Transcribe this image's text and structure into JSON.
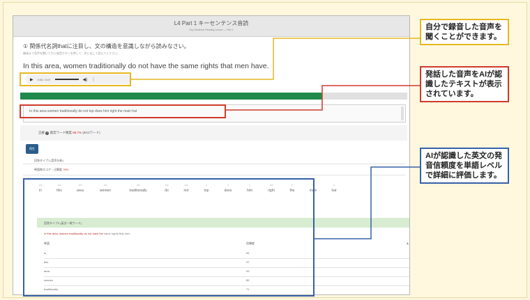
{
  "header": {
    "title": "L4 Part 1 キーセンテンス音読",
    "subtitle": "Key Sentence Reading Lesson — Part 1"
  },
  "question": {
    "text": "① 関係代名詞thatに注目し、文の構造を意識しながら読みなさい。",
    "note": "最後まで音声を聞いてから録音ボタンを押して、声に出して読んでください。",
    "sentence": "In this area, women traditionally do not have the same rights that men have."
  },
  "player": {
    "play_icon": "▶",
    "time": "0:00 / 0:07",
    "volume_icon": "◀)",
    "menu_icon": "⋮"
  },
  "progress": {
    "fill_fraction": 0.78
  },
  "recognized_text": "In this area women traditionally do not top does him right the main hat",
  "score": {
    "prefix": "正解",
    "label": "発音ワード精度",
    "value": "68.7%",
    "suffix": "(8/12ワード)"
  },
  "submit_label": "再生",
  "sections": {
    "overall": "回答タイプ1 (音声分析)",
    "word_score": "単語毎スコア・正解度",
    "word_score_value": "78%",
    "detail": "回答タイプ2 (英文一致ワード)"
  },
  "words": [
    {
      "score": "100",
      "word": "in"
    },
    {
      "score": "100",
      "word": "this"
    },
    {
      "score": "100",
      "word": "area"
    },
    {
      "score": "100",
      "word": "women"
    },
    {
      "score": "100",
      "word": "traditionally"
    },
    {
      "score": "100",
      "word": "do"
    },
    {
      "score": "100",
      "word": "not"
    },
    {
      "score": "0",
      "word": "top"
    },
    {
      "score": "0",
      "word": "does"
    },
    {
      "score": "0",
      "word": "him"
    },
    {
      "score": "100",
      "word": "right"
    },
    {
      "score": "0",
      "word": "the"
    },
    {
      "score": "0",
      "word": "main"
    },
    {
      "score": "0",
      "word": "hat"
    }
  ],
  "highlight": {
    "red": "In this area, women traditionally do not have the",
    "gray": "same rights that men"
  },
  "table": {
    "col1": "単語",
    "col2": "信頼度",
    "rows": [
      {
        "word": "in",
        "score": "95"
      },
      {
        "word": "this",
        "score": "97"
      },
      {
        "word": "area",
        "score": "93"
      },
      {
        "word": "women",
        "score": "85"
      },
      {
        "word": "traditionally",
        "score": "71"
      }
    ]
  },
  "callouts": {
    "record": "自分で録音した音声を聞くことができます。",
    "recognized": "発話した音声をAIが認識したテキストが表示されています。",
    "evaluation": "AIが認識した英文の発音信頼度を単語レベルで詳細に評価します。"
  },
  "colors": {
    "yellow": "#e6b820",
    "red": "#d03a2a",
    "blue": "#3560a8",
    "progress_green": "#1f8a4c"
  }
}
